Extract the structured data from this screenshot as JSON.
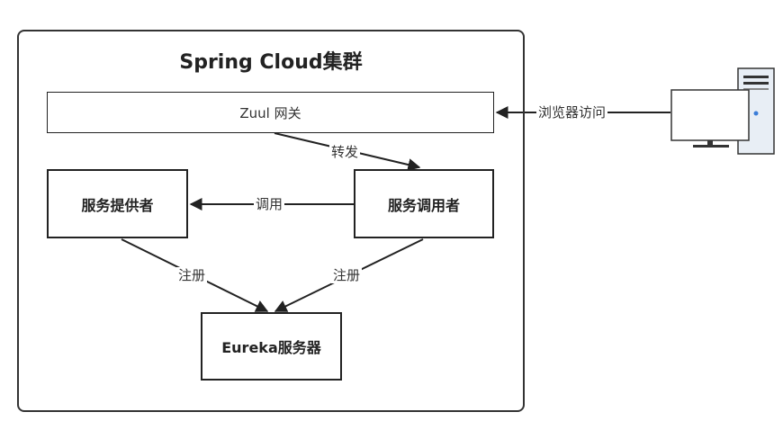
{
  "cluster": {
    "title": "Spring Cloud集群"
  },
  "nodes": {
    "zuul": "Zuul 网关",
    "provider": "服务提供者",
    "consumer": "服务调用者",
    "eureka": "Eureka服务器"
  },
  "edges": {
    "browser_access": "浏览器访问",
    "forward": "转发",
    "invoke": "调用",
    "register_provider": "注册",
    "register_consumer": "注册"
  },
  "icons": {
    "client": "desktop-computer-icon"
  },
  "colors": {
    "line": "#222222",
    "monitor_screen": "#ffffff",
    "tower": "#e8eef5",
    "tower_accent": "#3b7dd8"
  }
}
